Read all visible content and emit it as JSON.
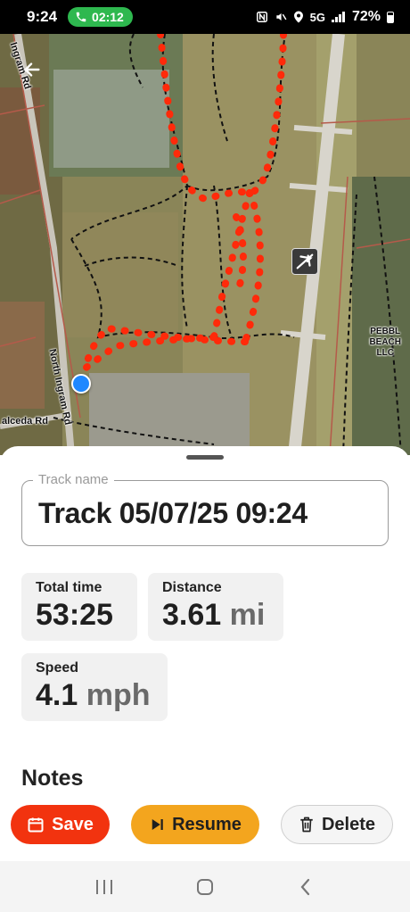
{
  "status_bar": {
    "time": "9:24",
    "call_timer": "02:12",
    "network": "5G",
    "battery": "72%"
  },
  "map": {
    "road_labels": [
      "Ingram Rd",
      "North Ingram Rd",
      "alceda Rd"
    ],
    "poi_label_lines": [
      "PEBBL",
      "BEACH",
      "LLC"
    ],
    "icons": [
      "back-arrow-icon",
      "airport-icon",
      "current-location-icon"
    ]
  },
  "track": {
    "field_label": "Track name",
    "name": "Track 05/07/25 09:24"
  },
  "stats": {
    "total_time": {
      "label": "Total time",
      "value": "53:25"
    },
    "distance": {
      "label": "Distance",
      "value": "3.61",
      "unit": "mi"
    },
    "speed": {
      "label": "Speed",
      "value": "4.1",
      "unit": "mph"
    }
  },
  "notes": {
    "heading": "Notes"
  },
  "actions": {
    "save": "Save",
    "resume": "Resume",
    "delete": "Delete"
  },
  "colors": {
    "save": "#f2330f",
    "resume": "#f3a51e",
    "track_line": "#ff2a0a",
    "location": "#1e88ff"
  }
}
